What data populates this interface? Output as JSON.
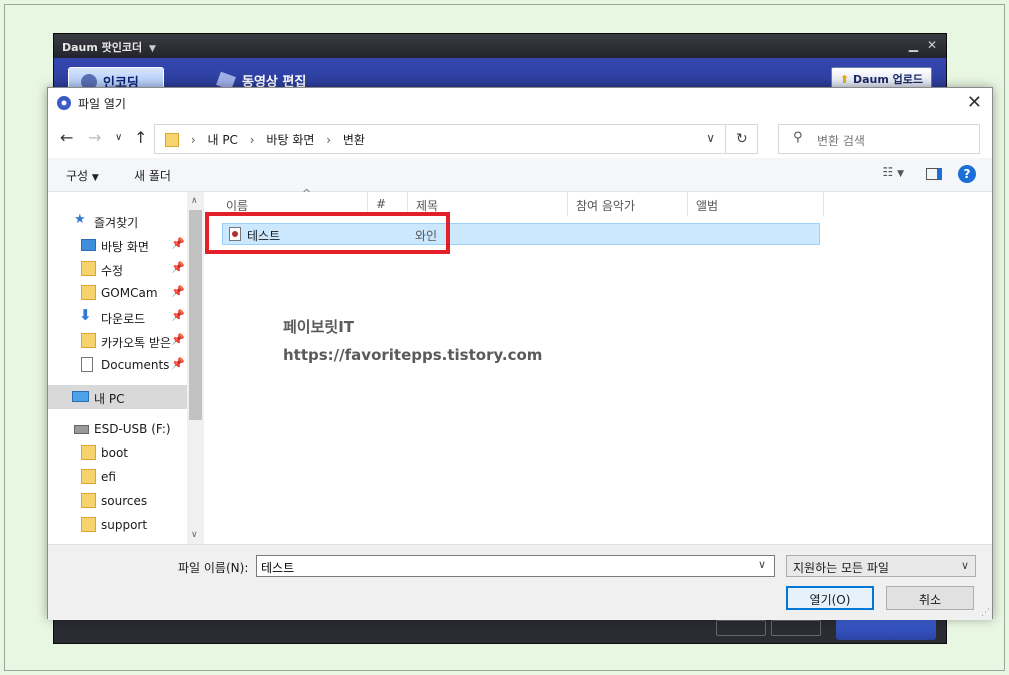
{
  "background_app": {
    "title": "Daum 팟인코더",
    "tab_encoding": "인코딩",
    "tab_edit": "동영상 편집",
    "upload_button": "Daum 업로드"
  },
  "dialog": {
    "title": "파일 열기",
    "address": {
      "segments": [
        "내 PC",
        "바탕 화면",
        "변환"
      ]
    },
    "search_placeholder": "변환 검색",
    "toolbar": {
      "organize": "구성",
      "new_folder": "새 폴더"
    },
    "nav": {
      "quick_access": "즐겨찾기",
      "items": [
        "바탕 화면",
        "수정",
        "GOMCam",
        "다운로드",
        "카카오톡 받은",
        "Documents"
      ],
      "this_pc": "내 PC",
      "drive": "ESD-USB (F:)",
      "drive_items": [
        "boot",
        "efi",
        "sources",
        "support"
      ]
    },
    "columns": [
      "이름",
      "#",
      "제목",
      "참여 음악가",
      "앨범"
    ],
    "files": [
      {
        "name": "테스트",
        "title": "와인"
      }
    ],
    "watermark": {
      "line1": "페이보릿IT",
      "line2": "https://favoritepps.tistory.com"
    },
    "filename_label": "파일 이름(N):",
    "filename_value": "테스트",
    "filetype": "지원하는 모든 파일",
    "open_button": "열기(O)",
    "cancel_button": "취소"
  },
  "colors": {
    "selection_bg": "#cce8ff",
    "highlight_box": "#e3202a",
    "primary_border": "#0078d7"
  }
}
